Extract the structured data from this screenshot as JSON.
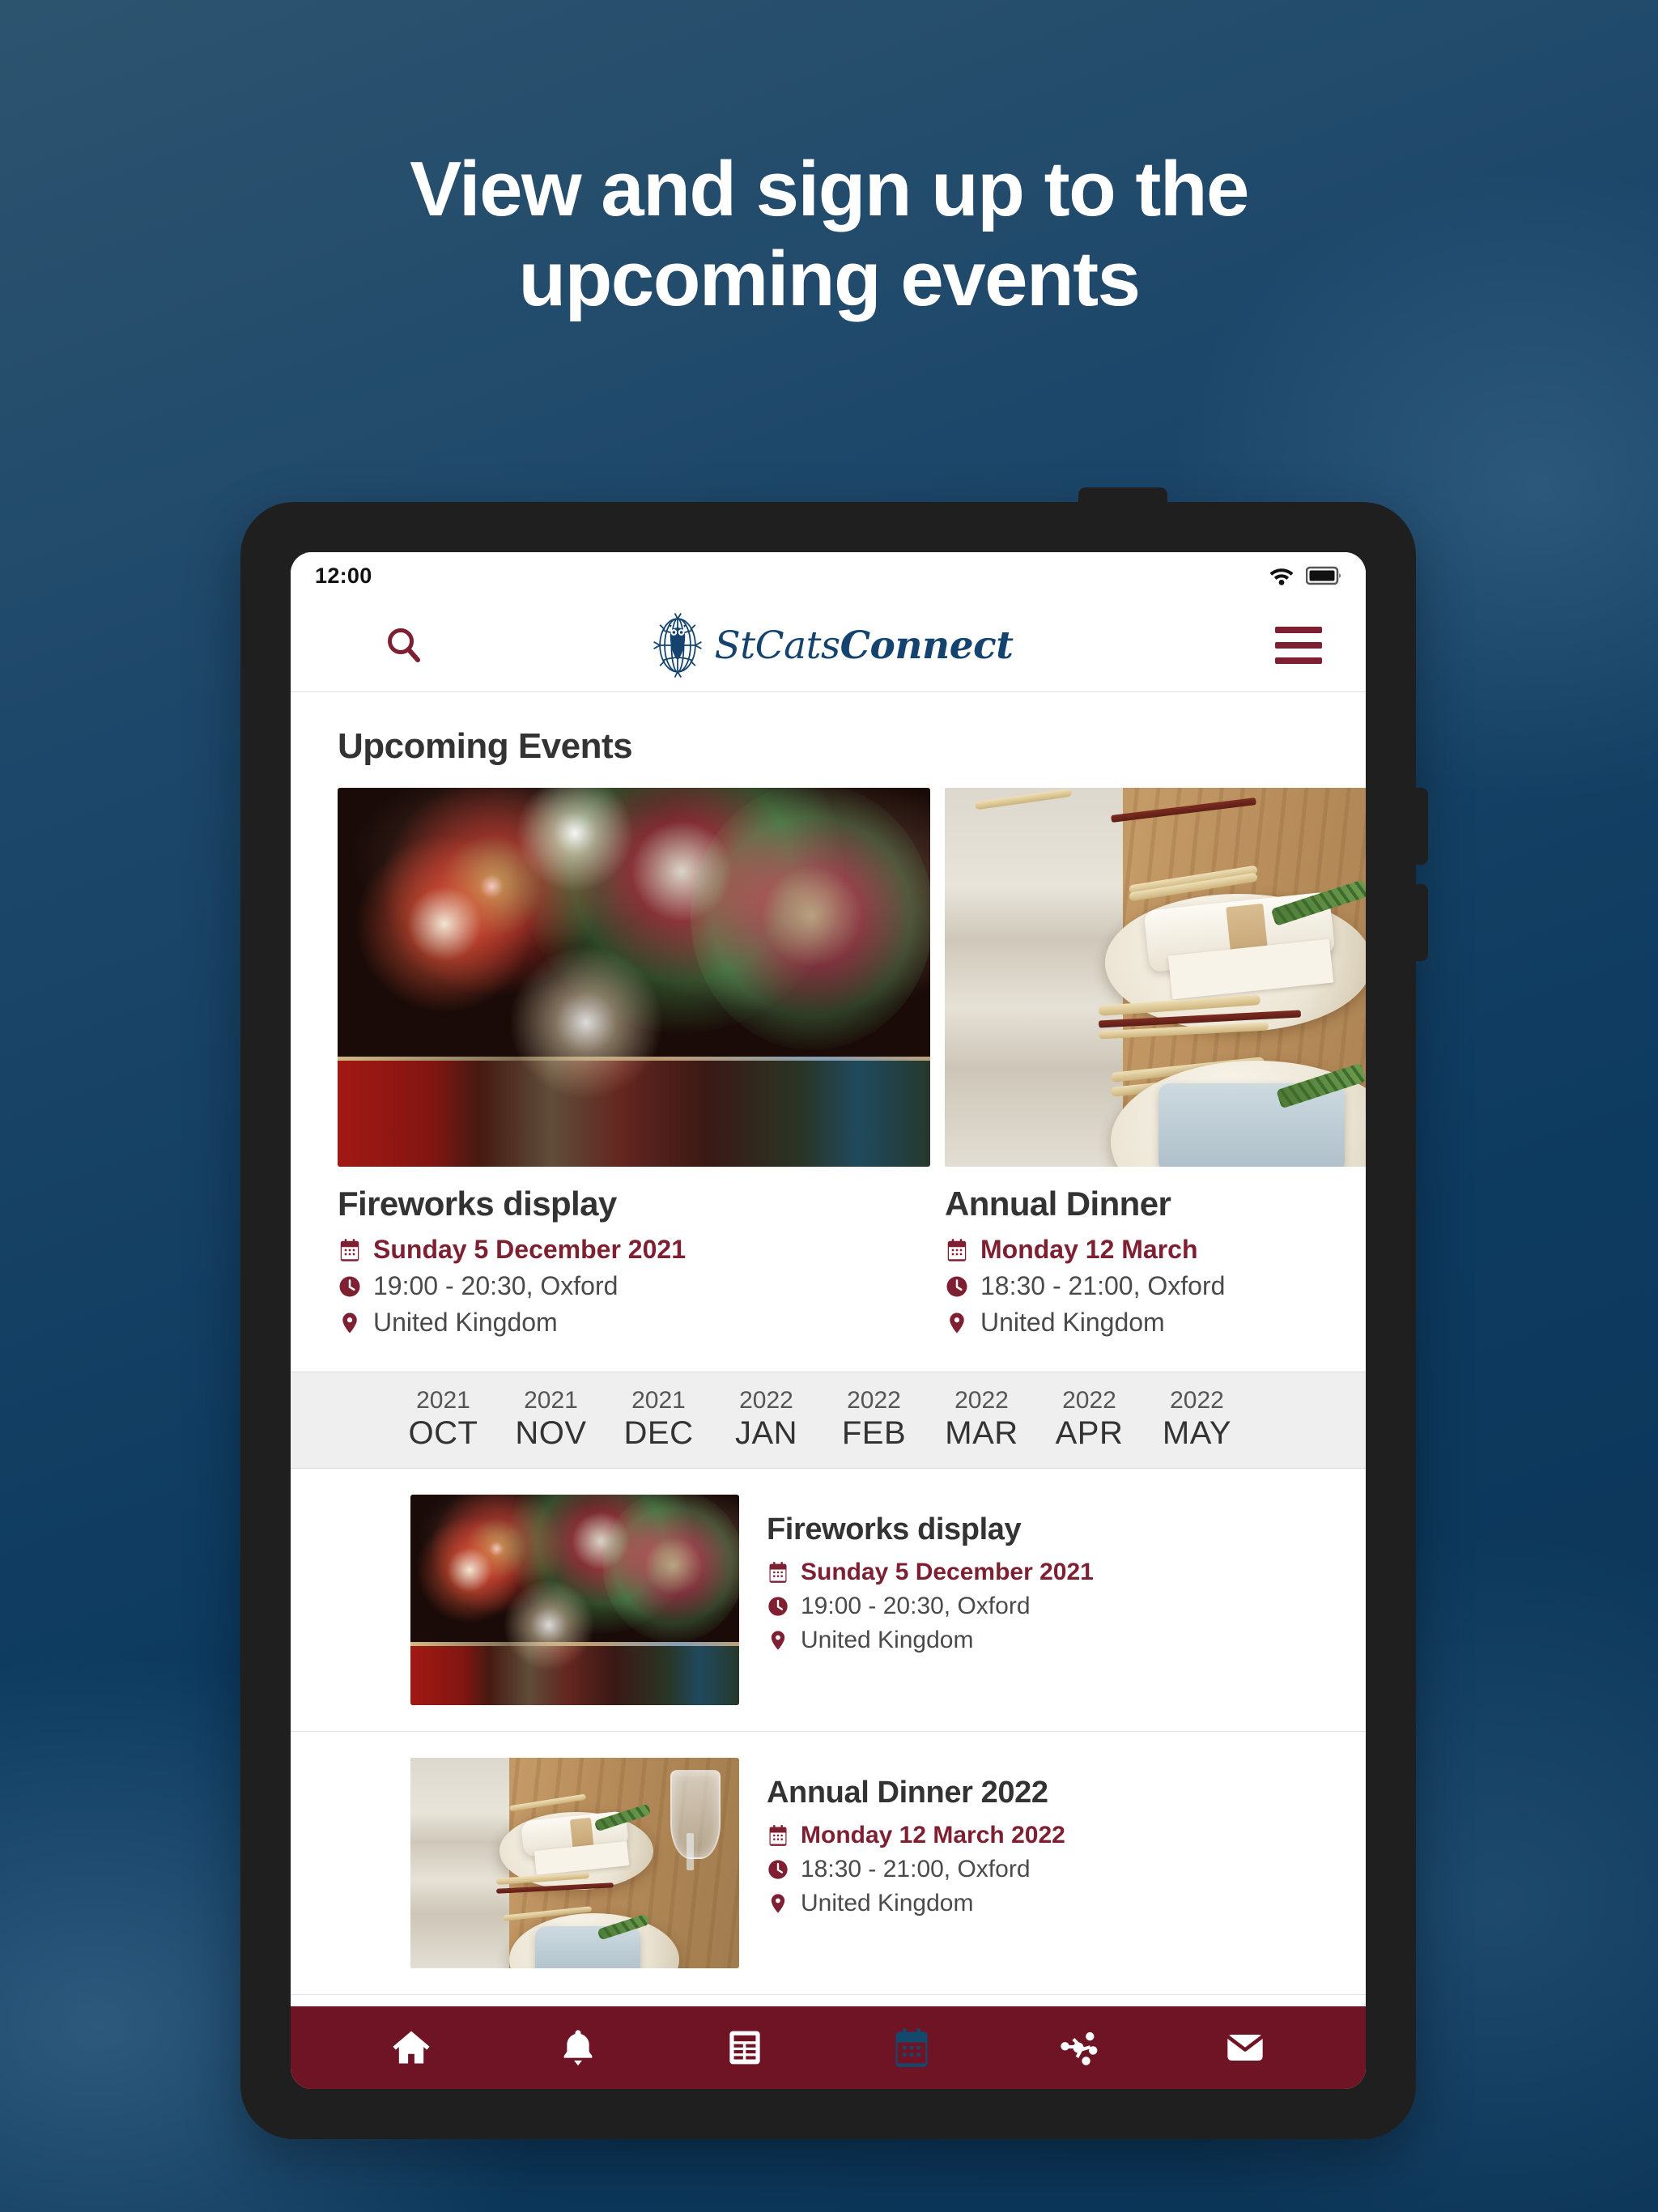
{
  "promo": {
    "headline_line1": "View and sign up to the",
    "headline_line2": "upcoming events"
  },
  "device": {
    "status": {
      "time": "12:00",
      "wifi_icon": "wifi-icon",
      "battery_icon": "battery-full-icon"
    }
  },
  "appbar": {
    "search_icon": "search-icon",
    "menu_icon": "hamburger-menu-icon",
    "brand_logo": "owl-compass-logo",
    "brand_part1": "StCats",
    "brand_part2": "Connect"
  },
  "main": {
    "section_title": "Upcoming Events",
    "featured": [
      {
        "title": "Fireworks display",
        "date": "Sunday 5 December 2021",
        "time": "19:00 - 20:30, Oxford",
        "location": "United Kingdom",
        "image": "fireworks-over-water-photo",
        "date_icon": "calendar-icon",
        "time_icon": "clock-icon",
        "location_icon": "map-pin-icon"
      },
      {
        "title": "Annual Dinner",
        "date": "Monday 12 March",
        "time": "18:30 - 21:00, Oxford",
        "location": "United Kingdom",
        "image": "dinner-table-setting-photo",
        "date_icon": "calendar-icon",
        "time_icon": "clock-icon",
        "location_icon": "map-pin-icon"
      }
    ],
    "months": [
      {
        "year": "2021",
        "month": "OCT"
      },
      {
        "year": "2021",
        "month": "NOV"
      },
      {
        "year": "2021",
        "month": "DEC"
      },
      {
        "year": "2022",
        "month": "JAN"
      },
      {
        "year": "2022",
        "month": "FEB"
      },
      {
        "year": "2022",
        "month": "MAR"
      },
      {
        "year": "2022",
        "month": "APR"
      },
      {
        "year": "2022",
        "month": "MAY"
      }
    ],
    "events": [
      {
        "title": "Fireworks display",
        "date": "Sunday 5 December 2021",
        "time": "19:00 - 20:30, Oxford",
        "location": "United Kingdom",
        "image": "fireworks-over-water-thumbnail",
        "date_icon": "calendar-icon",
        "time_icon": "clock-icon",
        "location_icon": "map-pin-icon"
      },
      {
        "title": "Annual Dinner 2022",
        "date": "Monday 12 March 2022",
        "time": "18:30 - 21:00, Oxford",
        "location": "United Kingdom",
        "image": "dinner-table-setting-thumbnail",
        "date_icon": "calendar-icon",
        "time_icon": "clock-icon",
        "location_icon": "map-pin-icon"
      }
    ]
  },
  "bottom_nav": {
    "items": [
      {
        "icon": "home-icon",
        "active": false
      },
      {
        "icon": "bell-notification-icon",
        "active": false
      },
      {
        "icon": "news-article-icon",
        "active": false
      },
      {
        "icon": "calendar-events-icon",
        "active": true
      },
      {
        "icon": "network-connections-icon",
        "active": false
      },
      {
        "icon": "envelope-mail-icon",
        "active": false
      }
    ]
  },
  "colors": {
    "brand_maroon": "#7e1f32",
    "nav_bar": "#6e1425",
    "nav_active": "#14496e",
    "brand_navy": "#13436e",
    "page_background": "#0d3a5f",
    "text_dark": "#333333"
  }
}
